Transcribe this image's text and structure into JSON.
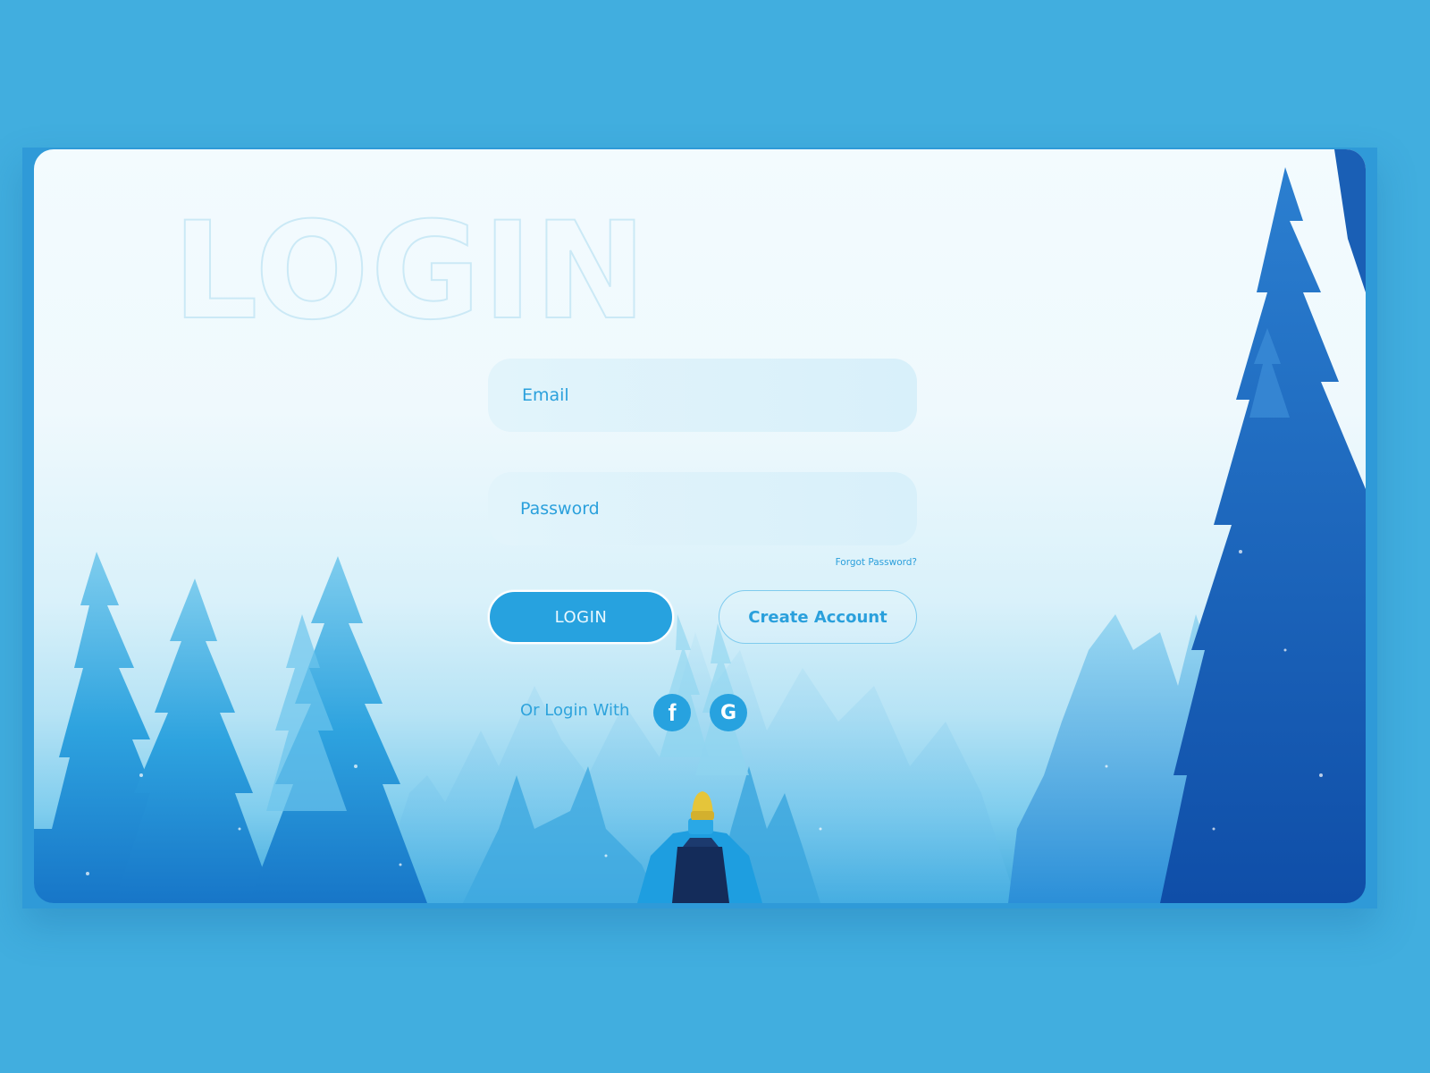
{
  "page": {
    "title_outline": "LOGIN",
    "colors": {
      "background": "#41aedf",
      "accent": "#27a2df",
      "field_bg": "#dcf2fb",
      "title_stroke": "#cbe9f6",
      "jacket": "#1e9ee0",
      "hat": "#e5c53a"
    }
  },
  "form": {
    "email": {
      "placeholder": "Email",
      "value": ""
    },
    "password": {
      "placeholder": "Password",
      "value": ""
    },
    "forgot_password": "Forgot Password?",
    "login_button": "LOGIN",
    "create_account_button": "Create Account",
    "or_login_with": "Or Login With",
    "social": [
      {
        "name": "facebook",
        "icon": "facebook-icon",
        "glyph": "f"
      },
      {
        "name": "google",
        "icon": "google-icon",
        "glyph": "G"
      }
    ]
  }
}
